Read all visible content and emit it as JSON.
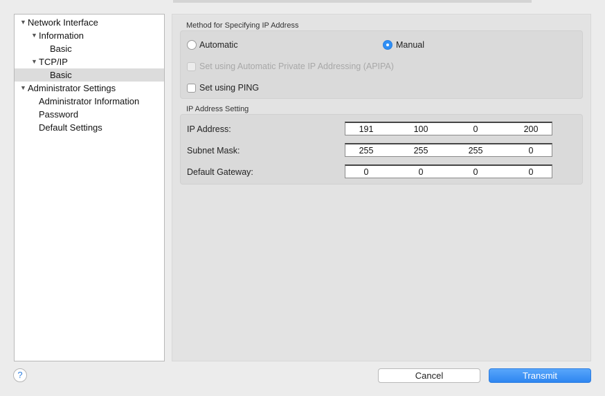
{
  "sidebar": {
    "items": [
      {
        "label": "Network Interface",
        "expanded": true,
        "level": 0
      },
      {
        "label": "Information",
        "expanded": true,
        "level": 1
      },
      {
        "label": "Basic",
        "level": 2
      },
      {
        "label": "TCP/IP",
        "expanded": true,
        "level": 1
      },
      {
        "label": "Basic",
        "level": 2,
        "selected": true
      },
      {
        "label": "Administrator Settings",
        "expanded": true,
        "level": 0
      },
      {
        "label": "Administrator Information",
        "level": 1
      },
      {
        "label": "Password",
        "level": 1
      },
      {
        "label": "Default Settings",
        "level": 1
      }
    ],
    "expander_glyph": "▼"
  },
  "method": {
    "title": "Method for Specifying IP Address",
    "automatic_label": "Automatic",
    "manual_label": "Manual",
    "selected": "Manual",
    "apipa_label": "Set using Automatic Private IP Addressing (APIPA)",
    "apipa_checked": false,
    "apipa_enabled": false,
    "ping_label": "Set using PING",
    "ping_checked": false
  },
  "ip_setting": {
    "title": "IP Address Setting",
    "fields": [
      {
        "label": "IP Address:",
        "octets": [
          "191",
          "100",
          "0",
          "200"
        ]
      },
      {
        "label": "Subnet Mask:",
        "octets": [
          "255",
          "255",
          "255",
          "0"
        ]
      },
      {
        "label": "Default Gateway:",
        "octets": [
          "0",
          "0",
          "0",
          "0"
        ]
      }
    ]
  },
  "footer": {
    "help_glyph": "?",
    "cancel_label": "Cancel",
    "transmit_label": "Transmit"
  },
  "colors": {
    "accent": "#2f8ff5",
    "selection": "#dcdcdc"
  }
}
